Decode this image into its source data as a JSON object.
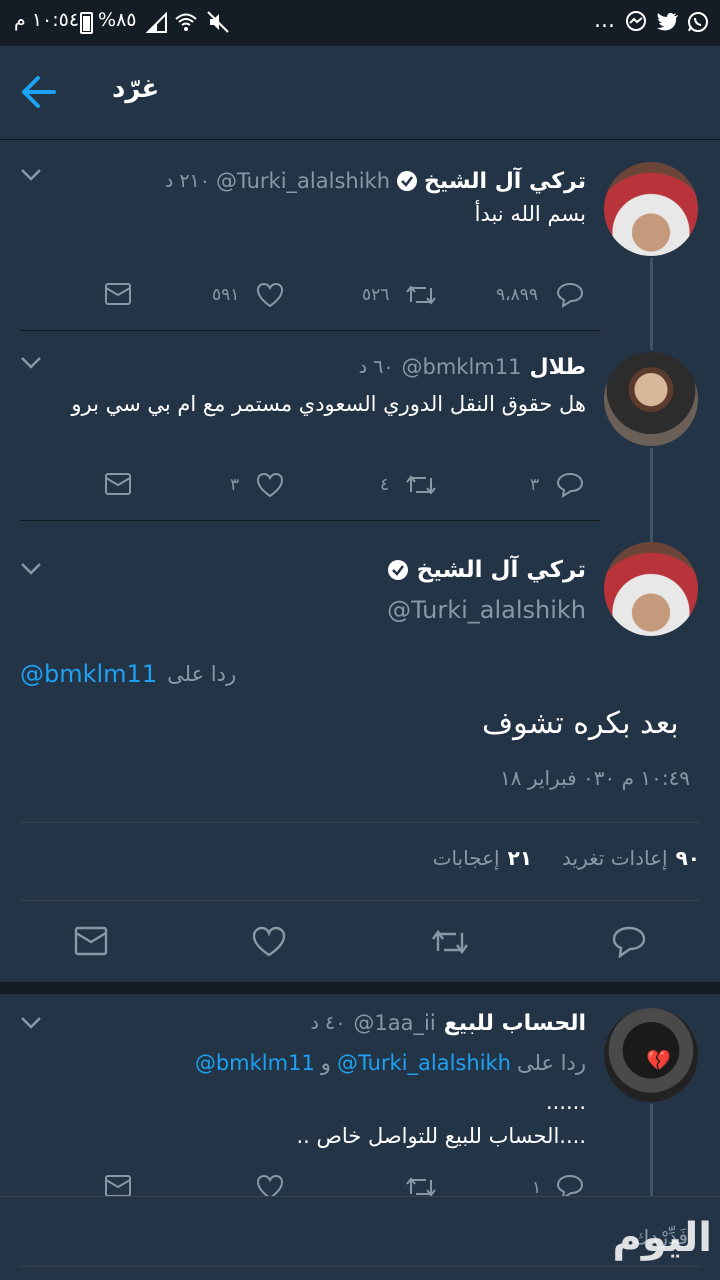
{
  "status_bar": {
    "time": "١٠:٥٤ م",
    "battery": "%٨٥",
    "more": "..."
  },
  "header": {
    "title": "غرّد"
  },
  "thread": {
    "tweet1": {
      "name": "تركي آل الشيخ",
      "handle": "@Turki_alalshikh",
      "time": "٢١٠ د",
      "text": "بسم الله نبدأ",
      "replies": "٩،٨٩٩",
      "retweets": "٥٢٦",
      "likes": "٥٩١"
    },
    "tweet2": {
      "name": "طلال",
      "handle": "@bmklm11",
      "time": "٦٠ د",
      "text": "هل حقوق النقل الدوري السعودي مستمر مع ام بي سي برو",
      "replies": "٣",
      "retweets": "٤",
      "likes": "٣"
    }
  },
  "main_tweet": {
    "name": "تركي آل الشيخ",
    "handle": "@Turki_alalshikh",
    "reply_to_prefix": "ردا على",
    "reply_to_handle": "@bmklm11",
    "text": "بعد بكره تشوف",
    "timestamp": "١٠:٤٩ م ٠٣٠ فبراير ١٨",
    "retweets_count": "٩٠",
    "retweets_label": "إعادات تغريد",
    "likes_count": "٢١",
    "likes_label": "إعجابات"
  },
  "reply_tweet": {
    "name": "الحساب للبيع",
    "handle": "@1aa_ii",
    "time": "٤٠ د",
    "reply_to_prefix": "ردا على",
    "reply_to_handle1": "@Turki_alalshikh",
    "conj": "و",
    "reply_to_handle2": "@bmklm11",
    "text_line1": "......",
    "text_line2": "....الحساب للبيع للتواصل خاص ..",
    "replies": "١"
  },
  "reply_box": {
    "placeholder": "فَدِّرْدك"
  },
  "watermark": "اليوم",
  "colors": {
    "background": "#243447",
    "status_bar": "#141d26",
    "accent": "#1da1f2",
    "muted": "#8899a6"
  }
}
